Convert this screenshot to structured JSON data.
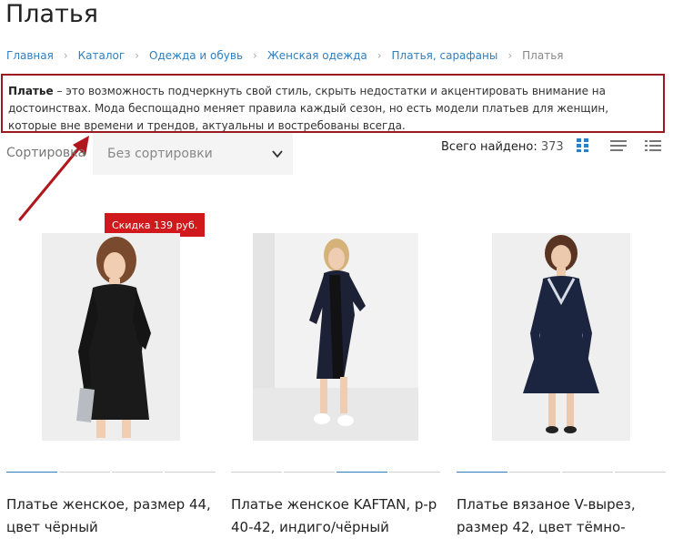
{
  "page": {
    "title": "Платья"
  },
  "breadcrumb": [
    {
      "label": "Главная"
    },
    {
      "label": "Каталог"
    },
    {
      "label": "Одежда и обувь"
    },
    {
      "label": "Женская одежда"
    },
    {
      "label": "Платья, сарафаны"
    },
    {
      "label": "Платья"
    }
  ],
  "description": {
    "bold": "Платье",
    "text": " – это возможность подчеркнуть свой стиль, скрыть недостатки и акцентировать внимание на достоинствах. Мода беспощадно меняет правила каждый сезон, но есть модели платьев для женщин, которые вне времени и трендов, актуальны и востребованы всегда."
  },
  "sort": {
    "label": "Сортировка",
    "selected": "Без сортировки"
  },
  "results": {
    "label": "Всего найдено:",
    "count": "373"
  },
  "colors": {
    "accent": "#2e7fc2",
    "discount": "#d0191d",
    "highlight_border": "#9a1a20"
  },
  "products": [
    {
      "discount": "Скидка 139 руб.",
      "name_line1": "Платье женское, размер 44,",
      "name_line2": "цвет чёрный"
    },
    {
      "name_line1": "Платье женское KAFTAN, р-р",
      "name_line2": "40-42, индиго/чёрный"
    },
    {
      "name_line1": "Платье вязаное V-вырез,",
      "name_line2": "размер 42, цвет тёмно-"
    }
  ]
}
